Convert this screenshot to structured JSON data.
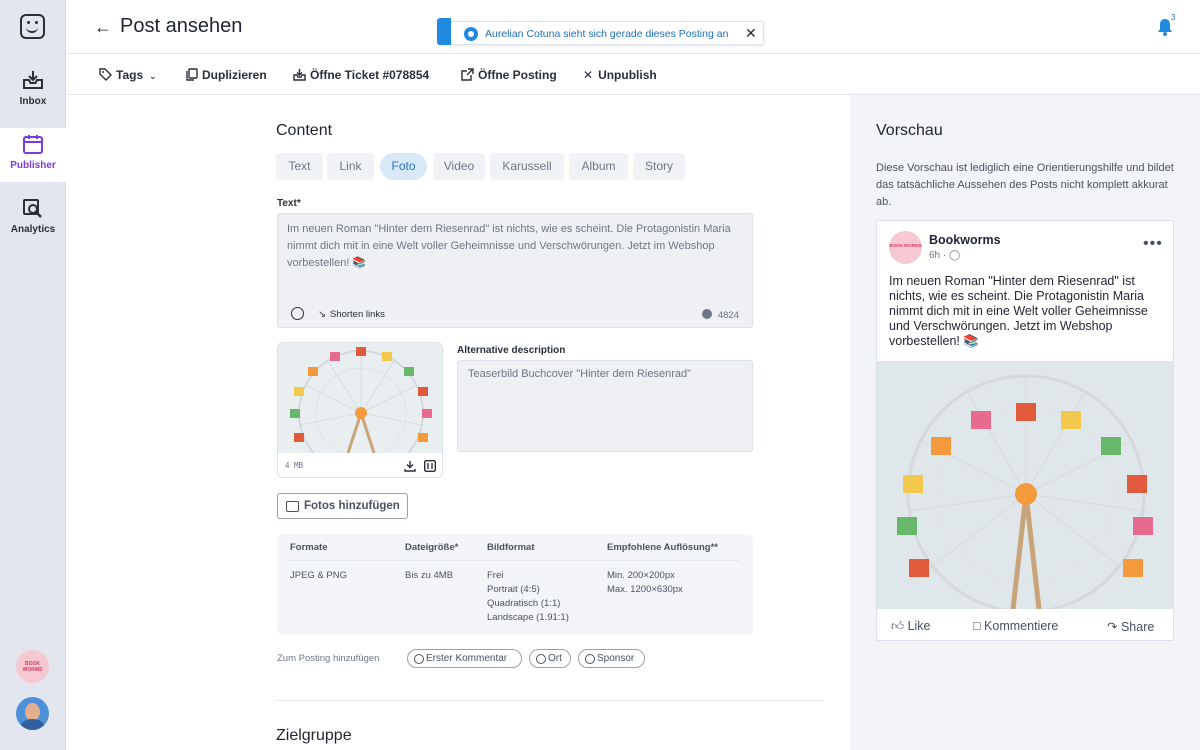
{
  "sidebar": {
    "items": [
      {
        "label": "Inbox"
      },
      {
        "label": "Publisher"
      },
      {
        "label": "Analytics"
      }
    ],
    "account_logo_text": "BOOK WORMS"
  },
  "header": {
    "title": "Post ansehen",
    "notification": {
      "message": "Aurelian Cotuna sieht sich gerade dieses Posting an"
    },
    "bell_badge": "3"
  },
  "toolbar": {
    "tags": "Tags",
    "duplicate": "Duplizieren",
    "ticket": "Öffne Ticket #078854",
    "open_post": "Öffne Posting",
    "unpublish": "Unpublish"
  },
  "content": {
    "section_title": "Content",
    "tabs": [
      "Text",
      "Link",
      "Foto",
      "Video",
      "Karussell",
      "Album",
      "Story"
    ],
    "active_tab": "Foto",
    "text_label": "Text*",
    "text_value": "Im neuen Roman \"Hinter dem Riesenrad\" ist nichts, wie es scheint. Die Protagonistin Maria nimmt dich mit in eine Welt voller Geheimnisse und Verschwörungen. Jetzt im Webshop vorbestellen! 📚",
    "shorten_links": "Shorten links",
    "char_count": "4824",
    "image_size": "4 MB",
    "alt_label": "Alternative description",
    "alt_value": "Teaserbild Buchcover \"Hinter dem Riesenrad\"",
    "add_photos": "Fotos hinzufügen",
    "spec_headers": [
      "Formate",
      "Dateigröße*",
      "Bildformat",
      "Empfohlene Auflösung**"
    ],
    "spec_values": {
      "formats": "JPEG & PNG",
      "filesize": "Bis zu 4MB",
      "bildformat": [
        "Frei",
        "Portrait (4:5)",
        "Quadratisch (1:1)",
        "Landscape (1.91:1)"
      ],
      "resolution": [
        "Min. 200×200px",
        "Max. 1200×630px"
      ]
    },
    "attach_label": "Zum Posting hinzufügen",
    "chips": [
      "Erster Kommentar",
      "Ort",
      "Sponsor"
    ],
    "next_section": "Zielgruppe"
  },
  "preview": {
    "title": "Vorschau",
    "description": "Diese Vorschau ist lediglich eine Orientierungshilfe und bildet das tatsächliche Aussehen des Posts nicht komplett akkurat ab.",
    "page_name": "Bookworms",
    "time": "6h ·",
    "body": "Im neuen Roman \"Hinter dem Riesenrad\" ist nichts, wie es scheint. Die Protagonistin Maria nimmt dich mit in eine Welt voller Geheimnisse und Verschwörungen. Jetzt im Webshop vorbestellen! 📚",
    "actions": [
      "Like",
      "Kommentiere",
      "Share"
    ]
  },
  "colors": {
    "accent": "#7a3be0",
    "info": "#1f8ae0",
    "tab_active_bg": "#d9e8f7"
  }
}
